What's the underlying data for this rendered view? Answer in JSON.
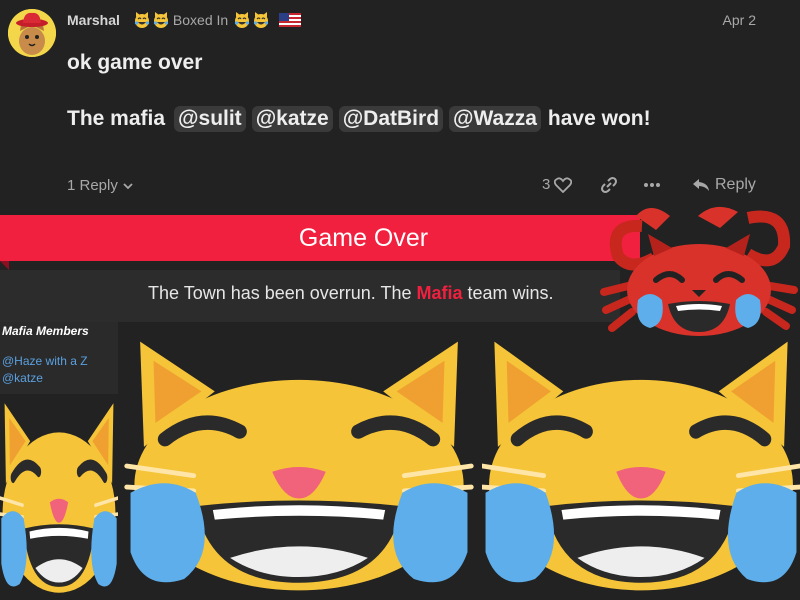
{
  "post": {
    "username": "Marshal",
    "flair": "Boxed In",
    "date": "Apr 2",
    "line1": "ok game over",
    "line2_prefix": "The mafia",
    "mentions": [
      "@sulit",
      "@katze",
      "@DatBird",
      "@Wazza"
    ],
    "line2_suffix": "have won!",
    "replies_label": "1 Reply",
    "like_count": "3",
    "reply_label": "Reply",
    "icons": [
      "cowboy-cat-avatar",
      "joy-cat-icon",
      "us-flag-icon",
      "chevron-down-icon",
      "heart-icon",
      "link-icon",
      "more-icon",
      "reply-arrow-icon"
    ]
  },
  "announcement": {
    "title": "Game Over",
    "text_before": "The Town has been overrun. The ",
    "team": "Mafia",
    "text_after": " team wins.",
    "accent_color": "#f2203f"
  },
  "members": {
    "title": "Mafia Members",
    "list": [
      "@Haze with a Z",
      "@katze"
    ]
  },
  "stickers": [
    "crab-joy-sticker",
    "joy-cat-sticker",
    "joy-cat-sticker",
    "joy-cat-sticker"
  ]
}
